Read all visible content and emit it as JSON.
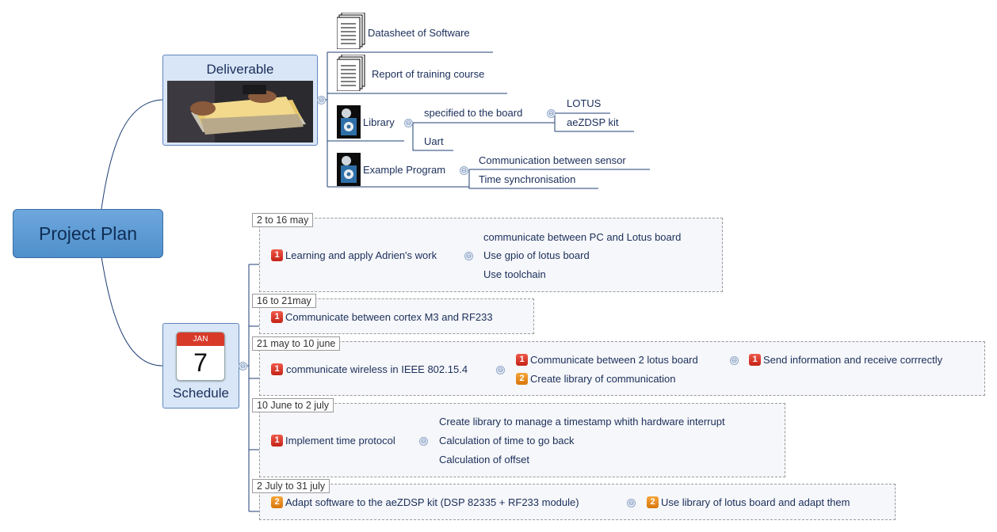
{
  "central": "Project Plan",
  "deliverable": {
    "title": "Deliverable",
    "items": {
      "datasheet": "Datasheet of Software",
      "report": "Report of training course",
      "library": "Library",
      "specified": "specified to the board",
      "lotus": "LOTUS",
      "aezdsp": "aeZDSP kit",
      "uart": "Uart",
      "example": "Example Program",
      "comm_sensor": "Communication between sensor",
      "time_sync": "Time synchronisation"
    }
  },
  "schedule": {
    "title": "Schedule",
    "calendar_month": "JAN",
    "calendar_day": "7",
    "groups": [
      {
        "label": "2 to 16 may",
        "task": "Learning and apply Adrien's work",
        "priority": "1",
        "children": [
          "communicate between PC and Lotus board",
          "Use gpio of lotus board",
          "Use toolchain"
        ]
      },
      {
        "label": "16 to 21may",
        "task": "Communicate between cortex M3 and RF233",
        "priority": "1"
      },
      {
        "label": "21 may to 10 june",
        "task": "communicate wireless in IEEE 802.15.4",
        "priority": "1",
        "children": [
          {
            "text": "Communicate between 2 lotus board",
            "priority": "1",
            "sub": {
              "text": "Send information and receive corrrectly",
              "priority": "1"
            }
          },
          {
            "text": "Create library of communication",
            "priority": "2"
          }
        ]
      },
      {
        "label": "10 June to 2 july",
        "task": "Implement time protocol",
        "priority": "1",
        "children": [
          "Create library to manage a timestamp whith hardware interrupt",
          "Calculation of time to go back",
          "Calculation of offset"
        ]
      },
      {
        "label": "2 July to 31 july",
        "task": "Adapt software to the aeZDSP kit (DSP 82335 + RF233 module)",
        "priority": "2",
        "sub": {
          "text": "Use library of lotus board and adapt them",
          "priority": "2"
        }
      }
    ]
  },
  "collapse_glyph": "⊖",
  "colors": {
    "line": "#1f3f74",
    "central": "#5b9bd5",
    "topic": "#d9e6f7",
    "priority1": "#d9352a",
    "priority2": "#e88a12"
  }
}
